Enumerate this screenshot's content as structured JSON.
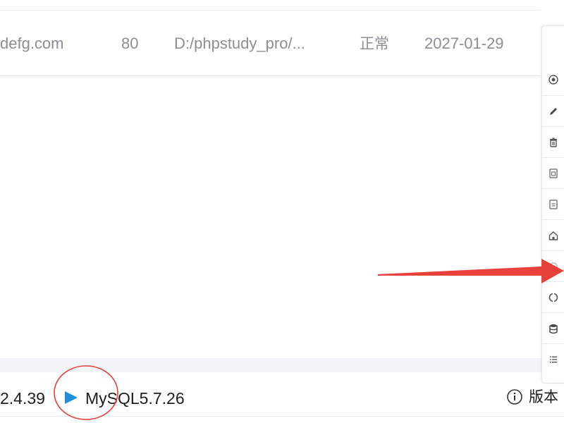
{
  "site_row": {
    "domain": "defg.com",
    "port": "80",
    "path": "D:/phpstudy_pro/...",
    "status": "正常",
    "expire_date": "2027-01-29"
  },
  "services": {
    "apache_version": "2.4.39",
    "mysql_label": "MySQL5.7.26"
  },
  "footer": {
    "version_label": "版本"
  },
  "side_toolbar": {
    "buttons": [
      {
        "icon": "radio-icon"
      },
      {
        "icon": "edit-icon"
      },
      {
        "icon": "trash-icon"
      },
      {
        "icon": "config-file-icon"
      },
      {
        "icon": "document-icon"
      },
      {
        "icon": "home-icon"
      },
      {
        "icon": "settings-icon"
      },
      {
        "icon": "refresh-icon"
      },
      {
        "icon": "database-icon"
      },
      {
        "icon": "list-icon"
      }
    ]
  },
  "colors": {
    "accent_blue": "#1e8fd8",
    "annotation_red": "#e8403a",
    "muted_text": "#8c8f96"
  }
}
